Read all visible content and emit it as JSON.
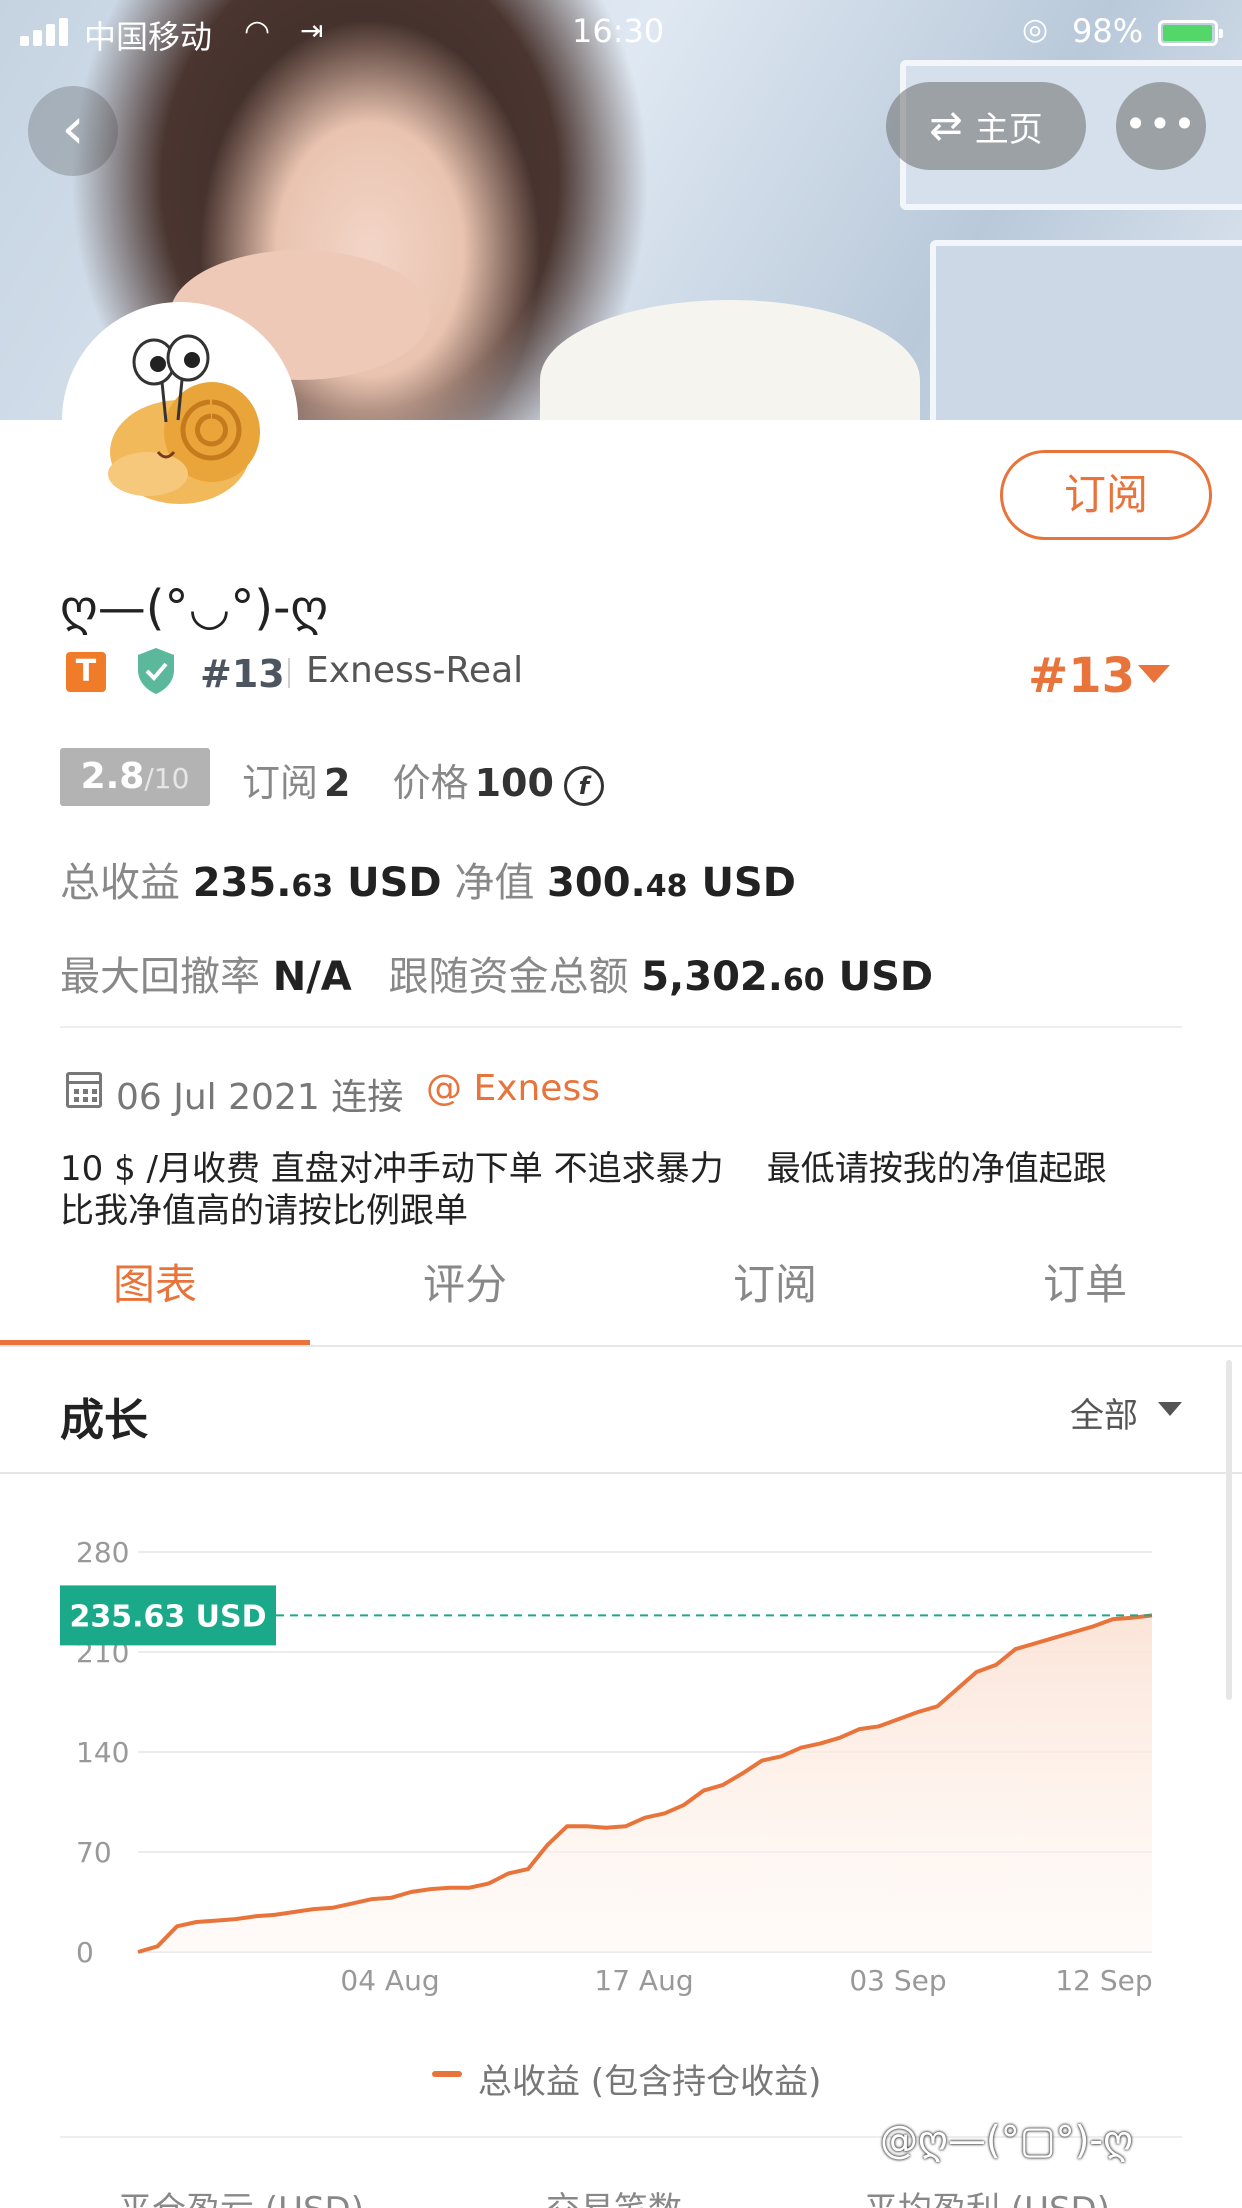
{
  "status_bar": {
    "carrier": "中国移动",
    "time": "16:30",
    "battery": "98%"
  },
  "top_bar": {
    "home_label": "主页"
  },
  "profile": {
    "subscribe_label": "订阅",
    "username": "ღ—(°◡°)-ღ",
    "badge_letter": "T",
    "rank_small": "#13",
    "broker": "Exness-Real",
    "rank_big": "#13",
    "score": "2.8",
    "score_max": "/10",
    "subscribers_label": "订阅",
    "subscribers_value": "2",
    "price_label": "价格",
    "price_value": "100",
    "price_currency_icon": "coin-icon",
    "total_profit_label": "总收益",
    "total_profit_int": "235.",
    "total_profit_dec": "63",
    "total_profit_unit": "USD",
    "equity_label": "净值",
    "equity_int": "300.",
    "equity_dec": "48",
    "equity_unit": "USD",
    "max_drawdown_label": "最大回撤率",
    "max_drawdown_value": "N/A",
    "follow_funds_label": "跟随资金总额",
    "follow_funds_int": "5,302.",
    "follow_funds_dec": "60",
    "follow_funds_unit": "USD",
    "connected_date": "06 Jul 2021 连接",
    "broker_link": "@ Exness",
    "description": "10 $ /月收费 直盘对冲手动下单 不追求暴力    最低请按我的净值起跟\n比我净值高的请按比例跟单"
  },
  "tabs": [
    {
      "label": "图表",
      "active": true
    },
    {
      "label": "评分",
      "active": false
    },
    {
      "label": "订阅",
      "active": false
    },
    {
      "label": "订单",
      "active": false
    }
  ],
  "growth": {
    "title": "成长",
    "range": "全部"
  },
  "chart_data": {
    "type": "area",
    "current_value_label": "235.63 USD",
    "current_value": 235.63,
    "ylim": [
      0,
      280
    ],
    "y_ticks": [
      "280",
      "210",
      "140",
      "70",
      "0"
    ],
    "x_ticks": [
      "04 Aug",
      "17 Aug",
      "03 Sep",
      "12 Sep"
    ],
    "series": [
      {
        "name": "总收益 (包含持仓收益)",
        "values": [
          0,
          4,
          18,
          21,
          22,
          23,
          25,
          26,
          28,
          30,
          31,
          34,
          37,
          38,
          42,
          44,
          45,
          45,
          48,
          55,
          58,
          75,
          88,
          88,
          87,
          88,
          94,
          97,
          103,
          113,
          117,
          125,
          134,
          137,
          143,
          146,
          150,
          156,
          158,
          163,
          168,
          172,
          184,
          196,
          201,
          212,
          216,
          220,
          224,
          228,
          233,
          234,
          235.63
        ]
      }
    ],
    "colors": {
      "line": "#e8743b",
      "fill": "#fbe3d6",
      "marker": "#1aaa8a"
    }
  },
  "stats_headers": [
    "平仓盈亏 (USD)",
    "交易笔数",
    "平均盈利 (USD)"
  ],
  "watermark": "@ღ—(°▢°)-ღ"
}
